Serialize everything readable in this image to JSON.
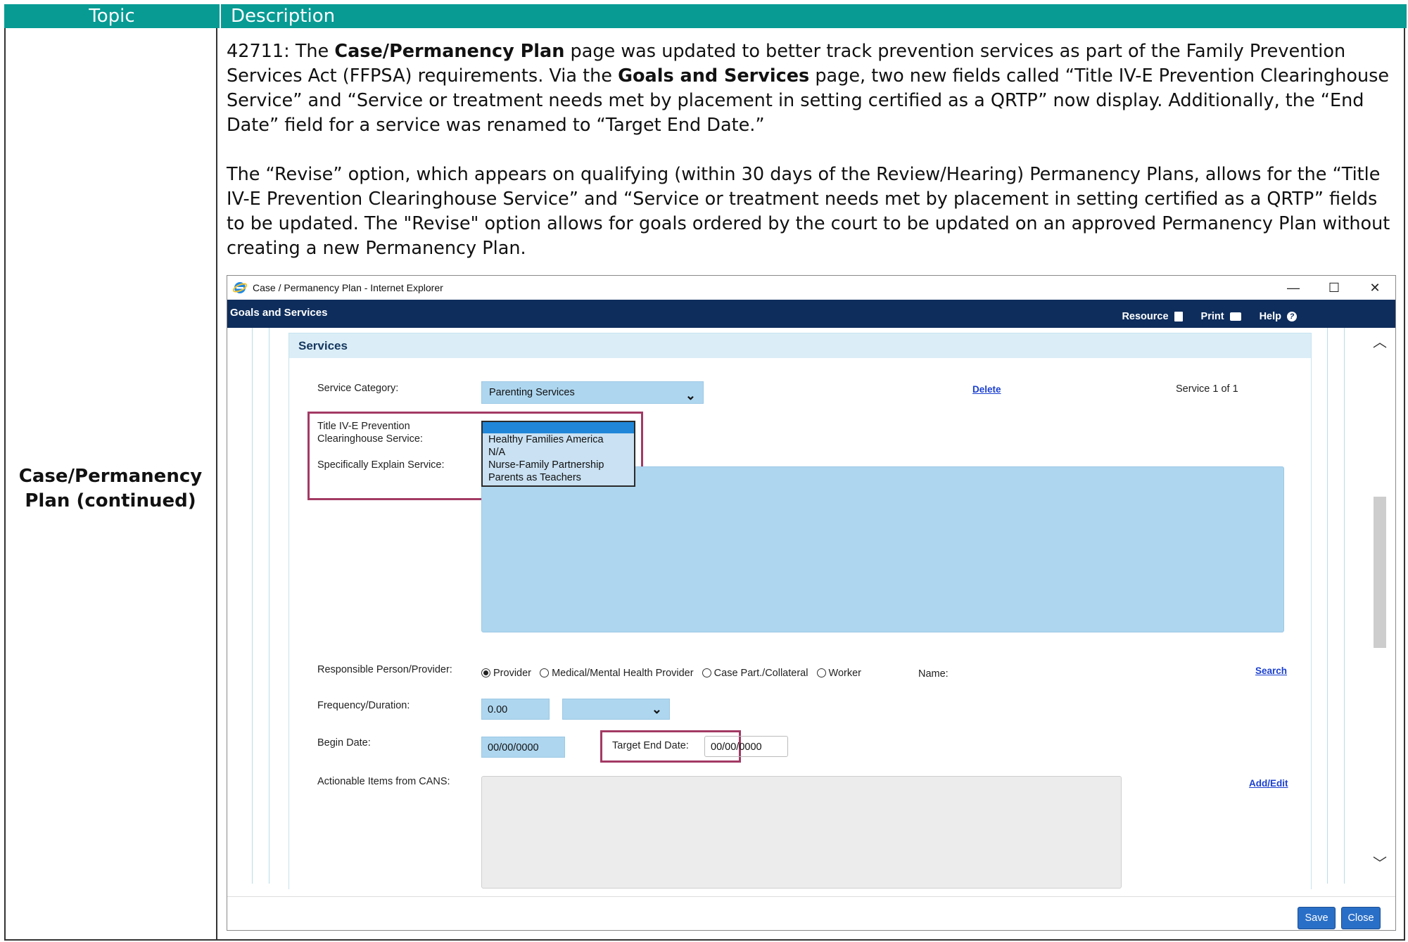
{
  "table": {
    "header_topic": "Topic",
    "header_description": "Description",
    "topic": "Case/Permanency Plan (continued)",
    "paragraph1": {
      "prefix": "42711: The ",
      "bold1": "Case/Permanency Plan",
      "mid1": " page was updated to better track prevention services as part of the Family Prevention Services Act (FFPSA) requirements. Via the ",
      "bold2": "Goals and Services",
      "rest": " page, two new fields called “Title IV-E Prevention Clearinghouse Service” and “Service or treatment needs met by placement in setting certified as a QRTP” now display. Additionally, the “End Date” field for a service was renamed to “Target End Date.”"
    },
    "paragraph2": "The “Revise” option, which appears on qualifying (within 30 days of the Review/Hearing) Permanency Plans, allows for the “Title IV-E Prevention Clearinghouse Service” and “Service or treatment needs met by placement in setting certified as a QRTP” fields to be updated. The \"Revise\" option allows for goals ordered by the court to be updated on an approved Permanency Plan without creating a new Permanency Plan."
  },
  "window": {
    "title": "Case / Permanency Plan - Internet Explorer",
    "controls": {
      "minimize": "—",
      "maximize": "☐",
      "close": "✕"
    },
    "app_title": "Goals and Services",
    "links": {
      "resource": "Resource",
      "print": "Print",
      "help": "Help"
    },
    "section": "Services",
    "service_category_label": "Service Category:",
    "service_category_value": "Parenting Services",
    "delete_link": "Delete",
    "service_counter": "Service 1 of 1",
    "clearinghouse_label_1": "Title IV-E Prevention",
    "clearinghouse_label_2": "Clearinghouse Service:",
    "clearinghouse_options": [
      "",
      "Healthy Families America",
      "N/A",
      "Nurse-Family Partnership",
      "Parents as Teachers"
    ],
    "explain_label": "Specifically Explain Service:",
    "responsible_label": "Responsible Person/Provider:",
    "radio_options": [
      "Provider",
      "Medical/Mental Health Provider",
      "Case Part./Collateral",
      "Worker"
    ],
    "name_label": "Name:",
    "search_link": "Search",
    "frequency_label": "Frequency/Duration:",
    "frequency_value": "0.00",
    "begin_label": "Begin Date:",
    "begin_value": "00/00/0000",
    "target_end_label": "Target End Date:",
    "target_end_value": "00/00/0000",
    "cans_label": "Actionable Items from CANS:",
    "add_edit_link": "Add/Edit",
    "save_button": "Save",
    "close_button": "Close"
  }
}
